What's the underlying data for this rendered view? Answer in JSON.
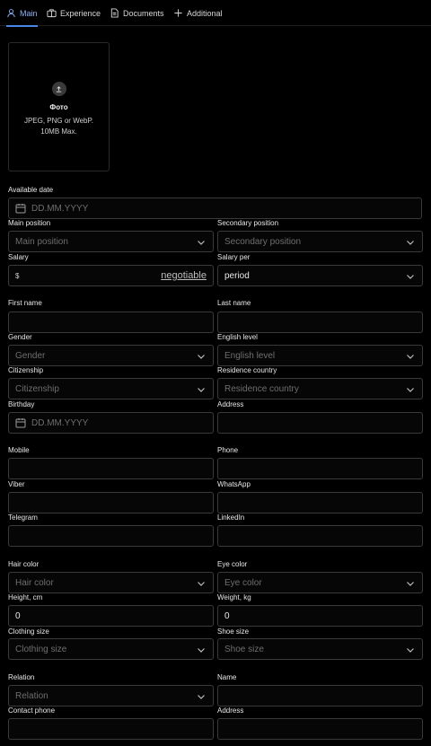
{
  "tabs": [
    {
      "label": "Main",
      "icon": "user-icon",
      "active": true
    },
    {
      "label": "Experience",
      "icon": "briefcase-icon"
    },
    {
      "label": "Documents",
      "icon": "document-icon"
    },
    {
      "label": "Additional",
      "icon": "plus-icon"
    }
  ],
  "photo": {
    "title": "Фото",
    "hint": "JPEG, PNG or WebP. 10MB Max."
  },
  "available_date": {
    "label": "Available date",
    "placeholder": "DD.MM.YYYY"
  },
  "main_position": {
    "label": "Main position",
    "placeholder": "Main position"
  },
  "secondary_position": {
    "label": "Secondary position",
    "placeholder": "Secondary position"
  },
  "salary": {
    "label": "Salary",
    "currency": "$",
    "negotiable": "negotiable"
  },
  "salary_per": {
    "label": "Salary per",
    "value": "period"
  },
  "first_name": {
    "label": "First name"
  },
  "last_name": {
    "label": "Last name"
  },
  "gender": {
    "label": "Gender",
    "placeholder": "Gender"
  },
  "english_level": {
    "label": "English level",
    "placeholder": "English level"
  },
  "citizenship": {
    "label": "Citizenship",
    "placeholder": "Citizenship"
  },
  "residence_country": {
    "label": "Residence country",
    "placeholder": "Residence country"
  },
  "birthday": {
    "label": "Birthday",
    "placeholder": "DD.MM.YYYY"
  },
  "address": {
    "label": "Address"
  },
  "mobile": {
    "label": "Mobile"
  },
  "phone": {
    "label": "Phone"
  },
  "viber": {
    "label": "Viber"
  },
  "whatsapp": {
    "label": "WhatsApp"
  },
  "telegram": {
    "label": "Telegram"
  },
  "linkedin": {
    "label": "LinkedIn"
  },
  "hair_color": {
    "label": "Hair color",
    "placeholder": "Hair color"
  },
  "eye_color": {
    "label": "Eye color",
    "placeholder": "Eye color"
  },
  "height": {
    "label": "Height, cm",
    "value": "0"
  },
  "weight": {
    "label": "Weight, kg",
    "value": "0"
  },
  "clothing_size": {
    "label": "Clothing size",
    "placeholder": "Clothing size"
  },
  "shoe_size": {
    "label": "Shoe size",
    "placeholder": "Shoe size"
  },
  "relation": {
    "label": "Relation",
    "placeholder": "Relation"
  },
  "contact_name": {
    "label": "Name"
  },
  "contact_phone": {
    "label": "Contact phone"
  },
  "contact_address": {
    "label": "Address"
  },
  "colors": {
    "accent": "#4a86e8",
    "background": "#000000",
    "border": "#3a3a3a"
  }
}
